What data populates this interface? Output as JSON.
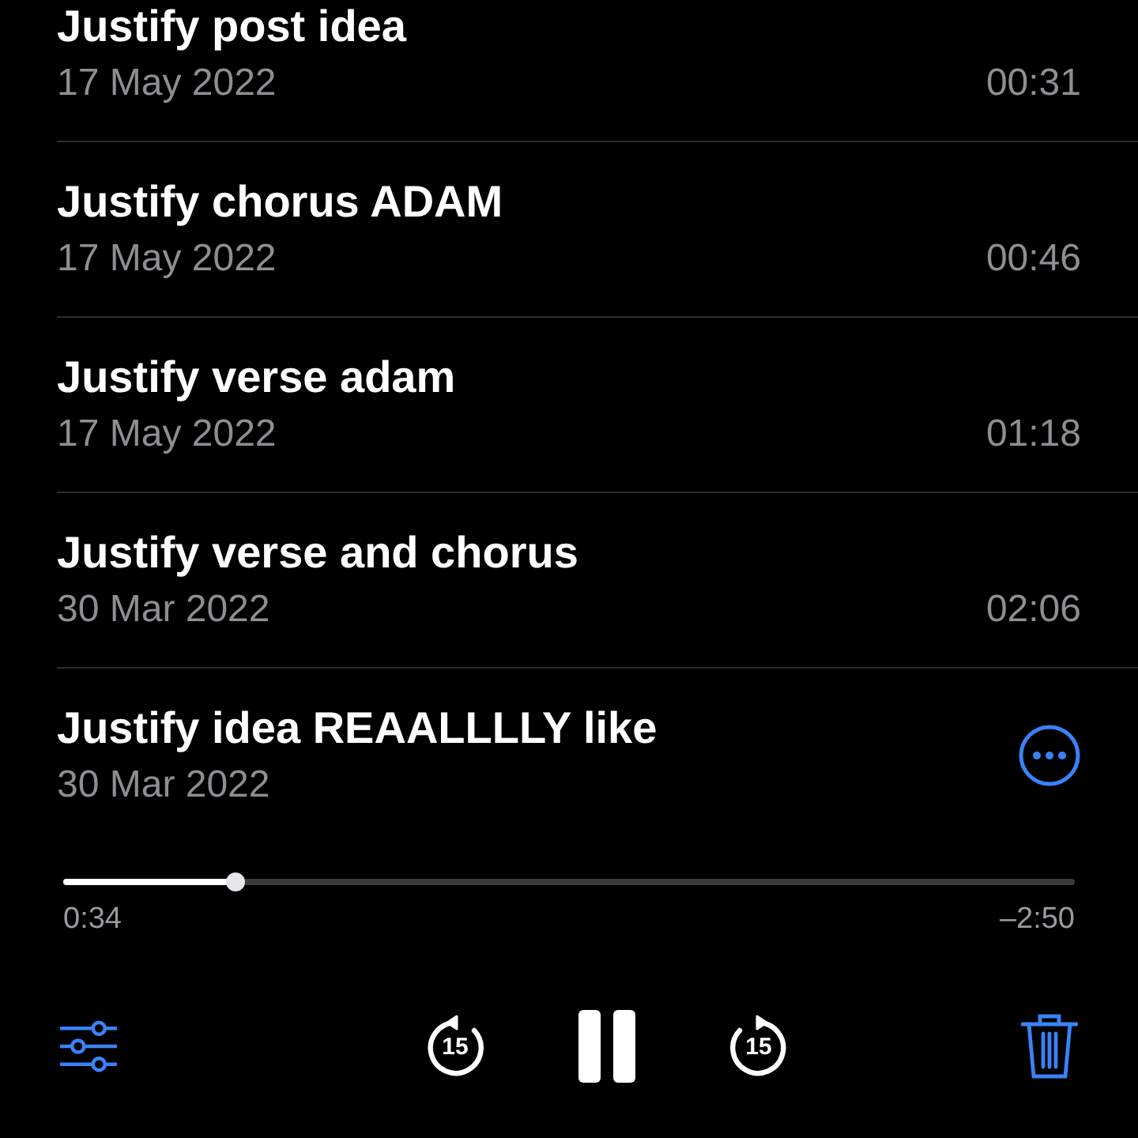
{
  "recordings": [
    {
      "title": "Justify post idea",
      "date": "17 May 2022",
      "duration": "00:31",
      "expanded": false
    },
    {
      "title": "Justify chorus ADAM",
      "date": "17 May 2022",
      "duration": "00:46",
      "expanded": false
    },
    {
      "title": "Justify verse adam",
      "date": "17 May 2022",
      "duration": "01:18",
      "expanded": false
    },
    {
      "title": "Justify verse and chorus",
      "date": "30 Mar 2022",
      "duration": "02:06",
      "expanded": false
    },
    {
      "title": "Justify idea REAALLLLY like",
      "date": "30 Mar 2022",
      "expanded": true
    }
  ],
  "player": {
    "level": 0.17,
    "elapsed": "0:34",
    "remaining": "–2:50",
    "skip_back": "15",
    "skip_forward": "15",
    "playing": true
  }
}
